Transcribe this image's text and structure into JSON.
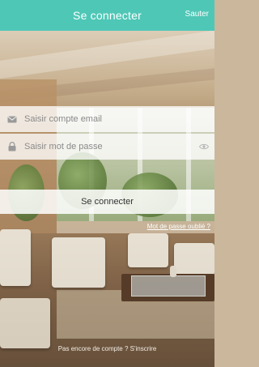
{
  "colors": {
    "accent": "#4ec7b6",
    "text_on_accent": "#ffffff"
  },
  "header": {
    "title": "Se connecter",
    "skip_label": "Sauter"
  },
  "form": {
    "email": {
      "placeholder": "Saisir compte email",
      "icon": "envelope-icon"
    },
    "password": {
      "placeholder": "Saisir mot de passe",
      "icon": "lock-icon",
      "toggle_icon": "eye-icon"
    },
    "login_label": "Se connecter",
    "forgot_label": "Mot de passe oublié ?"
  },
  "footer": {
    "signup_label": "Pas encore de compte ? S'inscrire"
  }
}
